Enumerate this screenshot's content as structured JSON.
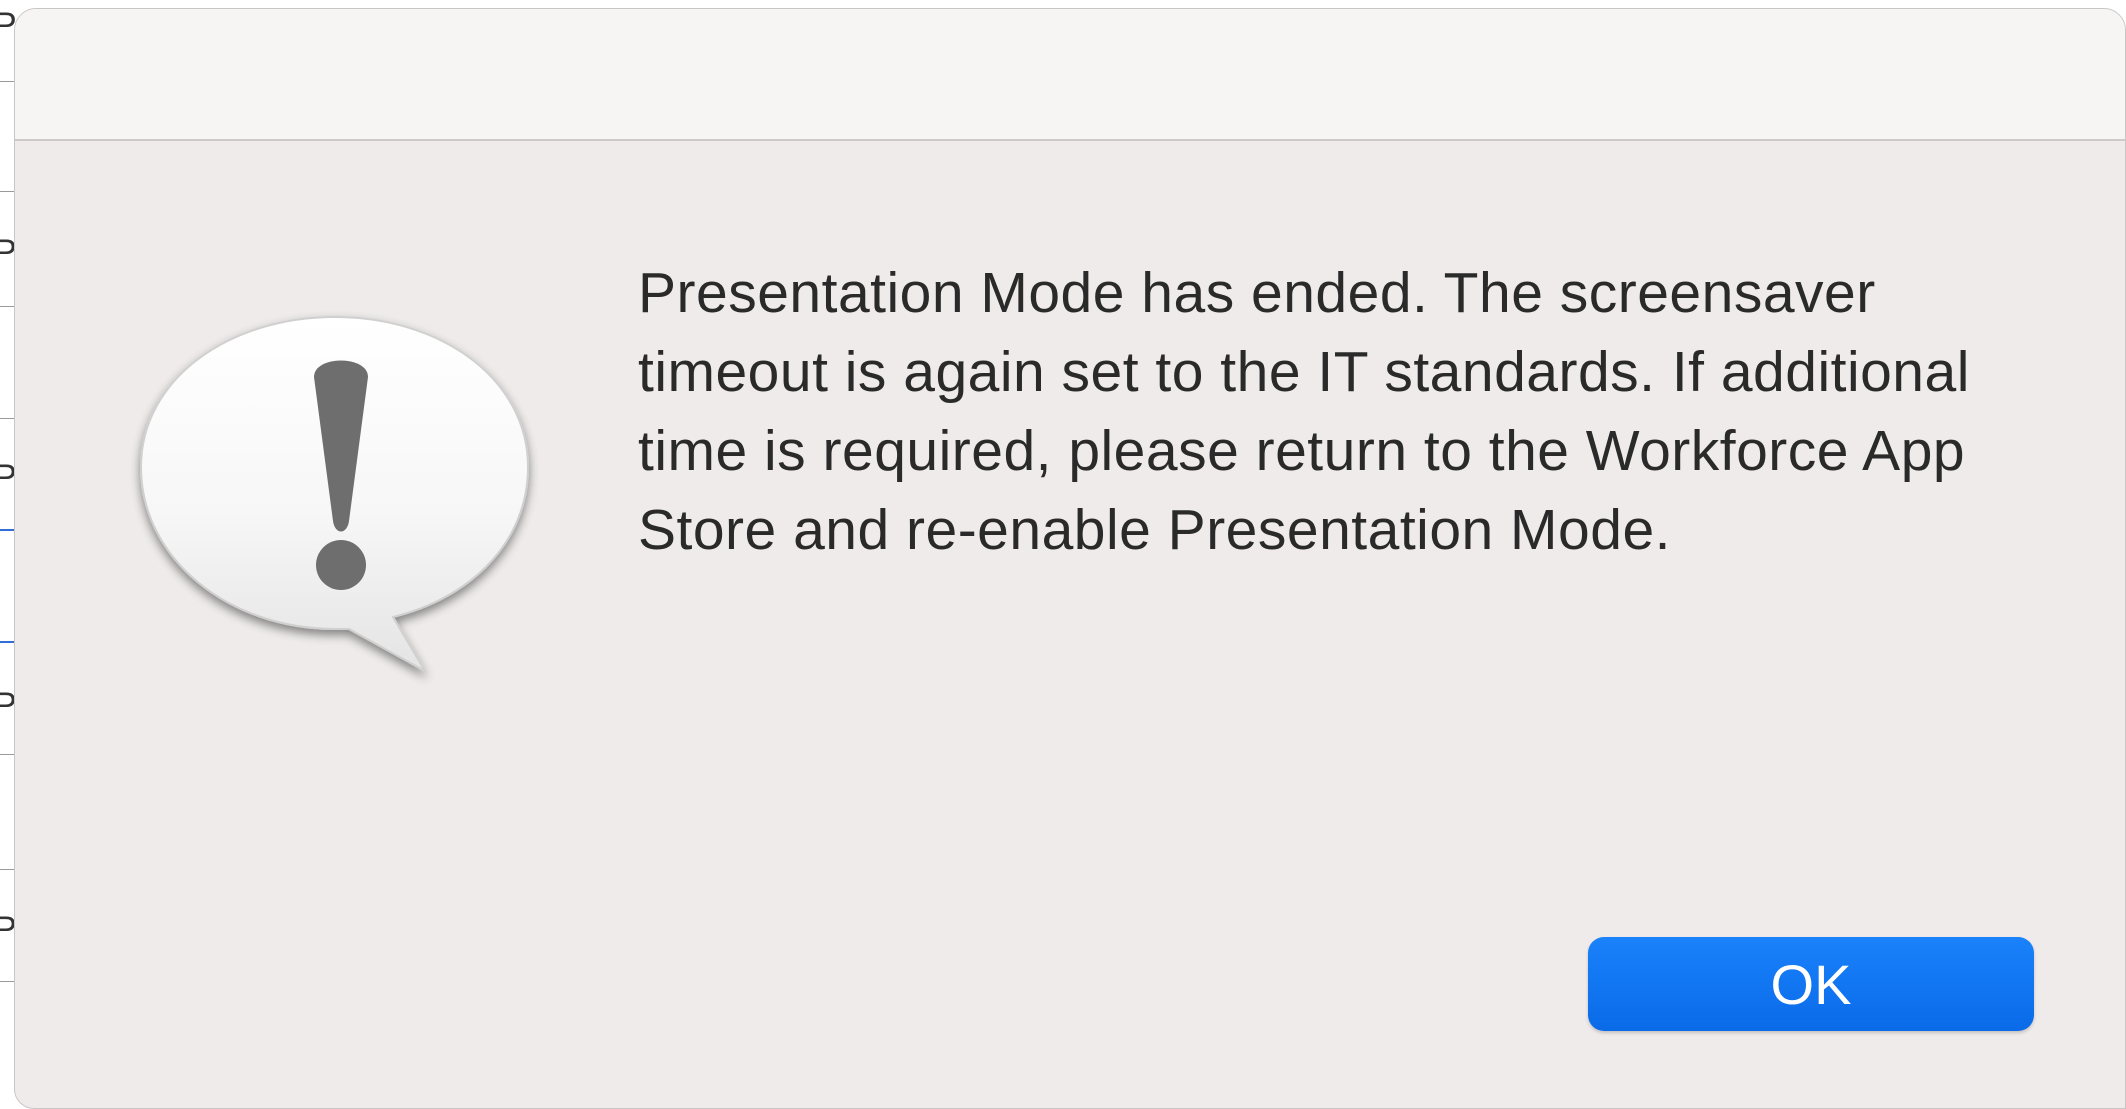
{
  "background_window": {
    "row_letters": [
      "Pa",
      "Pa",
      "Pa",
      "Pa",
      "Pa"
    ]
  },
  "dialog": {
    "icon": "caution-speech-bubble-icon",
    "message": "Presentation Mode has ended. The screensaver timeout is again set to the IT standards. If additional time is required, please return to the Workforce App Store and re-enable Presentation Mode.",
    "ok_label": "OK"
  },
  "colors": {
    "accent": "#0a6ae8",
    "dialog_background": "#eeebea",
    "titlebar_background": "#f7f5f4",
    "text": "#2b2a2a"
  }
}
